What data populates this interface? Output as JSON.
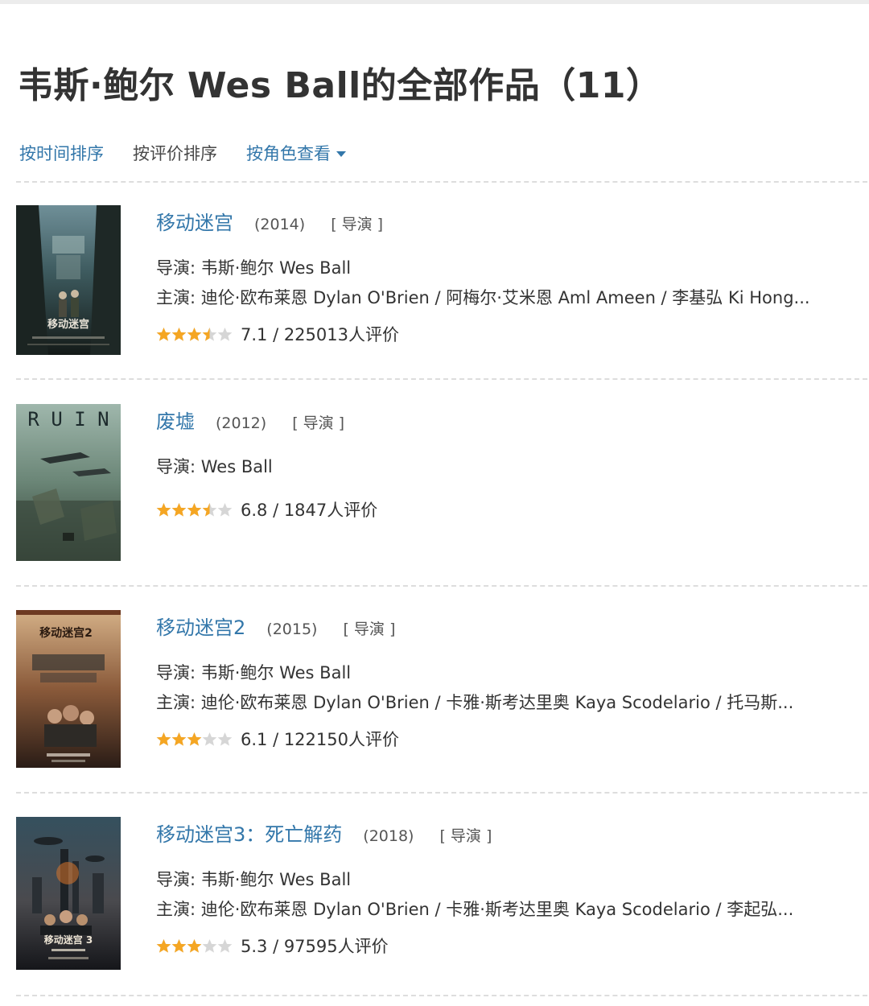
{
  "page": {
    "title": "韦斯·鲍尔 Wes Ball的全部作品（11）"
  },
  "sort": {
    "by_time": "按时间排序",
    "by_rating": "按评价排序",
    "by_role": "按角色查看"
  },
  "colors": {
    "link": "#3377aa",
    "star": "#f5a623",
    "star_empty": "#d6d6d6"
  },
  "movies": [
    {
      "title": "移动迷宫",
      "year": "(2014)",
      "role": "[ 导演 ]",
      "director": "导演: 韦斯·鲍尔 Wes Ball",
      "cast": "主演: 迪伦·欧布莱恩 Dylan O'Brien / 阿梅尔·艾米恩 Aml Ameen / 李基弘 Ki Hong...",
      "stars": 3.5,
      "rating": "7.1 / 225013人评价",
      "poster_text": "移动迷宫"
    },
    {
      "title": "废墟",
      "year": "(2012)",
      "role": "[ 导演 ]",
      "director": "导演: Wes Ball",
      "cast": "",
      "stars": 3.5,
      "rating": "6.8 / 1847人评价",
      "poster_text": "R U I N"
    },
    {
      "title": "移动迷宫2",
      "year": "(2015)",
      "role": "[ 导演 ]",
      "director": "导演: 韦斯·鲍尔 Wes Ball",
      "cast": "主演: 迪伦·欧布莱恩 Dylan O'Brien / 卡雅·斯考达里奥 Kaya Scodelario / 托马斯...",
      "stars": 3,
      "rating": "6.1 / 122150人评价",
      "poster_text": "移动迷宫2"
    },
    {
      "title": "移动迷宫3：死亡解药",
      "year": "(2018)",
      "role": "[ 导演 ]",
      "director": "导演: 韦斯·鲍尔 Wes Ball",
      "cast": "主演: 迪伦·欧布莱恩 Dylan O'Brien / 卡雅·斯考达里奥 Kaya Scodelario / 李起弘...",
      "stars": 3,
      "rating": "5.3 / 97595人评价",
      "poster_text": "移动迷宫 3"
    }
  ]
}
